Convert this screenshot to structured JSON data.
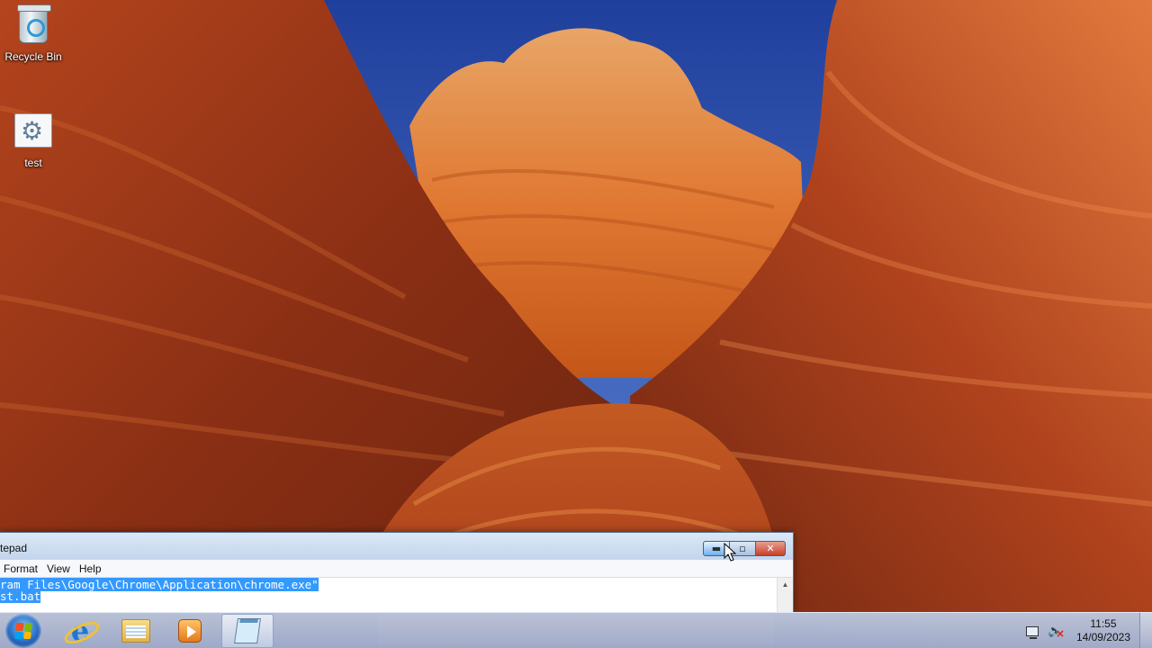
{
  "desktop": {
    "icons": [
      {
        "label": "Recycle Bin",
        "icon": "recycle-bin-icon"
      },
      {
        "label": "test",
        "icon": "batch-file-icon"
      }
    ]
  },
  "notepad": {
    "title": "tepad",
    "menu": [
      "Format",
      "View",
      "Help"
    ],
    "lines": [
      "ram Files\\Google\\Chrome\\Application\\chrome.exe\"",
      "st.bat"
    ],
    "buttons": {
      "minimize": "minimize-icon",
      "maximize": "maximize-icon",
      "close": "close-icon"
    }
  },
  "taskbar": {
    "apps": [
      {
        "name": "internet-explorer",
        "icon": "internet-explorer-icon"
      },
      {
        "name": "windows-explorer",
        "icon": "folder-icon"
      },
      {
        "name": "media-player",
        "icon": "media-player-icon"
      },
      {
        "name": "notepad",
        "icon": "notepad-icon",
        "active": true
      }
    ],
    "tray": {
      "icons": [
        "network-icon",
        "volume-muted-icon"
      ],
      "time": "11:55",
      "date": "14/09/2023"
    }
  },
  "colors": {
    "selection": "#3399ff",
    "close_button": "#c7402a",
    "sky": "#1c3a9a",
    "rock": "#c8501f"
  }
}
